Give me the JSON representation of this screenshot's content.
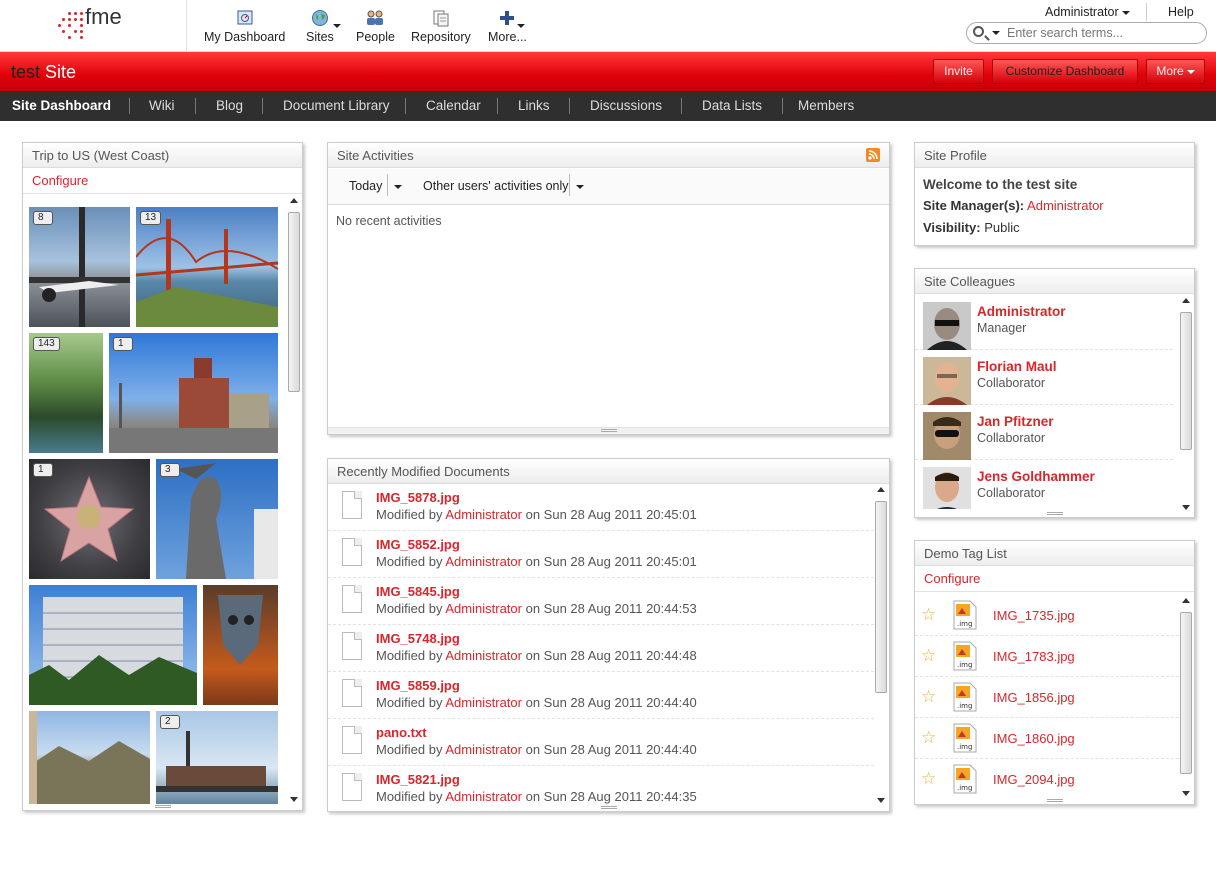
{
  "header": {
    "logo_text": "fme",
    "nav": [
      {
        "label": "My Dashboard",
        "icon": "dashboard-icon"
      },
      {
        "label": "Sites",
        "icon": "globe-icon"
      },
      {
        "label": "People",
        "icon": "people-icon"
      },
      {
        "label": "Repository",
        "icon": "repository-icon"
      },
      {
        "label": "More...",
        "icon": "plus-icon"
      }
    ],
    "user_menu": "Administrator",
    "help": "Help",
    "search_placeholder": "Enter search terms..."
  },
  "site": {
    "prefix": "test",
    "suffix": "Site",
    "buttons": {
      "invite": "Invite",
      "customize": "Customize Dashboard",
      "more": "More"
    }
  },
  "site_nav": [
    "Site Dashboard",
    "Wiki",
    "Blog",
    "Document Library",
    "Calendar",
    "Links",
    "Discussions",
    "Data Lists",
    "Members"
  ],
  "gallery": {
    "title": "Trip to US (West Coast)",
    "configure": "Configure",
    "badges": [
      "8",
      "13",
      "143",
      "1",
      "1",
      "3",
      "2"
    ]
  },
  "activities": {
    "title": "Site Activities",
    "range": "Today",
    "filter": "Other users' activities only",
    "empty": "No recent activities"
  },
  "documents": {
    "title": "Recently Modified Documents",
    "modified_by_prefix": "Modified by",
    "items": [
      {
        "name": "IMG_5878.jpg",
        "user": "Administrator",
        "date": "on Sun 28 Aug 2011 20:45:01"
      },
      {
        "name": "IMG_5852.jpg",
        "user": "Administrator",
        "date": "on Sun 28 Aug 2011 20:45:01"
      },
      {
        "name": "IMG_5845.jpg",
        "user": "Administrator",
        "date": "on Sun 28 Aug 2011 20:44:53"
      },
      {
        "name": "IMG_5748.jpg",
        "user": "Administrator",
        "date": "on Sun 28 Aug 2011 20:44:48"
      },
      {
        "name": "IMG_5859.jpg",
        "user": "Administrator",
        "date": "on Sun 28 Aug 2011 20:44:40"
      },
      {
        "name": "pano.txt",
        "user": "Administrator",
        "date": "on Sun 28 Aug 2011 20:44:40"
      },
      {
        "name": "IMG_5821.jpg",
        "user": "Administrator",
        "date": "on Sun 28 Aug 2011 20:44:35"
      }
    ]
  },
  "profile": {
    "title": "Site Profile",
    "welcome": "Welcome to the test site",
    "manager_label": "Site Manager(s):",
    "manager": "Administrator",
    "visibility_label": "Visibility:",
    "visibility": "Public"
  },
  "colleagues": {
    "title": "Site Colleagues",
    "items": [
      {
        "name": "Administrator",
        "role": "Manager"
      },
      {
        "name": "Florian Maul",
        "role": "Collaborator"
      },
      {
        "name": "Jan Pfitzner",
        "role": "Collaborator"
      },
      {
        "name": "Jens Goldhammer",
        "role": "Collaborator"
      }
    ]
  },
  "tags": {
    "title": "Demo Tag List",
    "configure": "Configure",
    "icon_label": ".img",
    "items": [
      "IMG_1735.jpg",
      "IMG_1783.jpg",
      "IMG_1856.jpg",
      "IMG_1860.jpg",
      "IMG_2094.jpg"
    ]
  },
  "colors": {
    "accent": "#d8262b",
    "navbar": "#2f2f2f",
    "sitebar": "#e0000a"
  }
}
